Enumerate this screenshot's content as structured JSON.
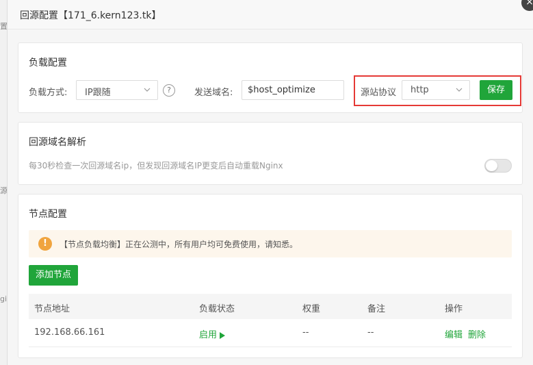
{
  "backdrop": {
    "fragments": [
      "置",
      "源",
      "gi"
    ]
  },
  "dialog": {
    "title": "回源配置【171_6.kern123.tk】",
    "close_label": "×"
  },
  "load_config": {
    "title": "负载配置",
    "method_label": "负载方式:",
    "method_value": "IP跟随",
    "help_label": "?",
    "host_label": "发送域名:",
    "host_value": "$host_optimize",
    "protocol_label": "源站协议",
    "protocol_value": "http",
    "save_label": "保存"
  },
  "dns_resolve": {
    "title": "回源域名解析",
    "description": "每30秒检查一次回源域名ip，但发现回源域名IP更变后自动重载Nginx",
    "enabled": false
  },
  "nodes": {
    "title": "节点配置",
    "notice_icon": "!",
    "notice": "【节点负载均衡】正在公测中，所有用户均可免费使用，请知悉。",
    "add_label": "添加节点",
    "columns": [
      "节点地址",
      "负载状态",
      "权重",
      "备注",
      "操作"
    ],
    "rows": [
      {
        "address": "192.168.66.161",
        "status": "启用",
        "weight": "--",
        "remark": "--",
        "edit": "编辑",
        "delete": "删除"
      }
    ]
  },
  "colors": {
    "primary_green": "#20a53a",
    "highlight_red": "#e53935",
    "notice_bg": "#fdf6ec",
    "notice_icon": "#f0a43e"
  },
  "icons": {
    "close": "close-icon",
    "help": "question-icon",
    "chevron": "chevron-down-icon",
    "warning": "warning-icon",
    "play": "play-icon"
  }
}
